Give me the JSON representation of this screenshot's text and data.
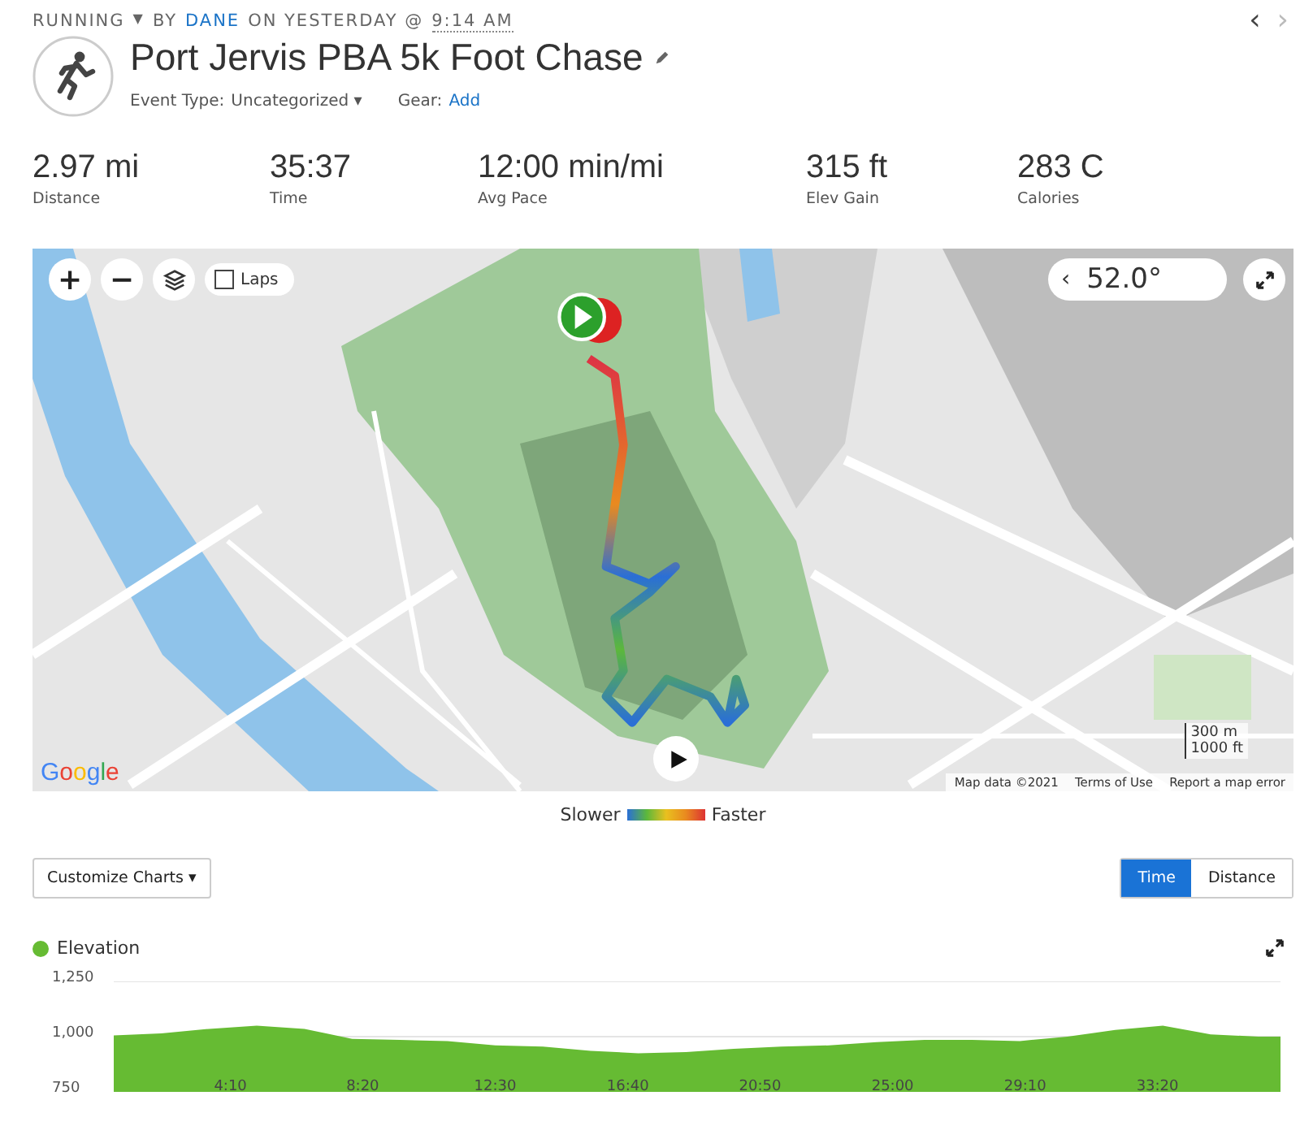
{
  "header": {
    "activity_type": "RUNNING",
    "type_caret": "▼",
    "by_label": "BY",
    "author": "DANE",
    "date_label": "ON YESTERDAY @",
    "time": "9:14 AM",
    "prev": "‹",
    "next": "›"
  },
  "title": "Port Jervis PBA 5k Foot Chase",
  "event_type": {
    "label": "Event Type:",
    "value": "Uncategorized",
    "caret": "▾"
  },
  "gear": {
    "label": "Gear:",
    "link": "Add"
  },
  "stats": [
    {
      "value": "2.97 mi",
      "label": "Distance"
    },
    {
      "value": "35:37",
      "label": "Time"
    },
    {
      "value": "12:00 min/mi",
      "label": "Avg Pace"
    },
    {
      "value": "315 ft",
      "label": "Elev Gain"
    },
    {
      "value": "283 C",
      "label": "Calories"
    }
  ],
  "map": {
    "kind": "picture",
    "zoom_in": "+",
    "zoom_out": "−",
    "laps": {
      "label": "Laps",
      "checked": false
    },
    "heading": {
      "arrow": "‹",
      "value": "52.0°"
    },
    "logo": "Google",
    "scale": [
      "300 m",
      "1000 ft"
    ],
    "attribution": [
      "Map data ©2021",
      "Terms of Use",
      "Report a map error"
    ]
  },
  "legend": {
    "slow": "Slower",
    "fast": "Faster"
  },
  "customize": "Customize Charts ▾",
  "axis_toggle": [
    {
      "label": "Time",
      "selected": true
    },
    {
      "label": "Distance",
      "selected": false
    }
  ],
  "elevation": {
    "color": "#66bb33",
    "chart_data": {
      "type": "area",
      "x": [
        0.5,
        2,
        3.5,
        5,
        6.5,
        8,
        9.5,
        11,
        12.5,
        14,
        15.5,
        17,
        18.5,
        20,
        21.5,
        23,
        24.5,
        26,
        27.5,
        29,
        30.5,
        32,
        33.5,
        35,
        36.5,
        37.2
      ],
      "series": [
        {
          "name": "Elevation",
          "color": "#66bb33",
          "values": [
            1005,
            1015,
            1035,
            1050,
            1035,
            990,
            985,
            980,
            960,
            955,
            935,
            925,
            930,
            945,
            955,
            960,
            975,
            985,
            985,
            980,
            1000,
            1030,
            1050,
            1010,
            1000,
            1000
          ]
        }
      ],
      "xlim": [
        0.5,
        37.2
      ],
      "ylim": [
        750,
        1250
      ],
      "yticks": [
        {
          "value": 750,
          "label": "750"
        },
        {
          "value": 1000,
          "label": "1,000"
        },
        {
          "value": 1250,
          "label": "1,250"
        }
      ],
      "xticks": [
        {
          "value": 4.17,
          "label": "4:10"
        },
        {
          "value": 8.33,
          "label": "8:20"
        },
        {
          "value": 12.5,
          "label": "12:30"
        },
        {
          "value": 16.67,
          "label": "16:40"
        },
        {
          "value": 20.83,
          "label": "20:50"
        },
        {
          "value": 25,
          "label": "25:00"
        },
        {
          "value": 29.17,
          "label": "29:10"
        },
        {
          "value": 33.33,
          "label": "33:20"
        }
      ]
    }
  }
}
